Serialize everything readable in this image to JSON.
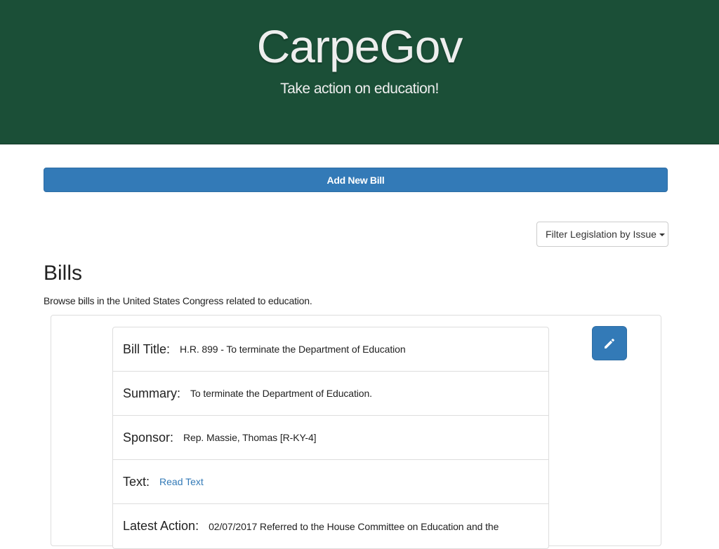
{
  "header": {
    "title": "CarpeGov",
    "tagline": "Take action on education!"
  },
  "actions": {
    "add_bill_label": "Add New Bill",
    "filter_label": "Filter Legislation by Issue"
  },
  "bills_section": {
    "heading": "Bills",
    "description": "Browse bills in the United States Congress related to education."
  },
  "bill": {
    "title_label": "Bill Title:",
    "title_value": "H.R. 899 - To terminate the Department of Education",
    "summary_label": "Summary:",
    "summary_value": "To terminate the Department of Education.",
    "sponsor_label": "Sponsor:",
    "sponsor_value": "Rep. Massie, Thomas [R-KY-4]",
    "text_label": "Text:",
    "text_link": "Read Text",
    "latest_action_label": "Latest Action:",
    "latest_action_value": "02/07/2017 Referred to the House Committee on Education and the"
  },
  "icons": {
    "edit": "pencil-icon",
    "dropdown": "caret-down-icon"
  },
  "colors": {
    "header_bg": "#1b4f37",
    "primary": "#337ab7",
    "link": "#337ab7"
  }
}
